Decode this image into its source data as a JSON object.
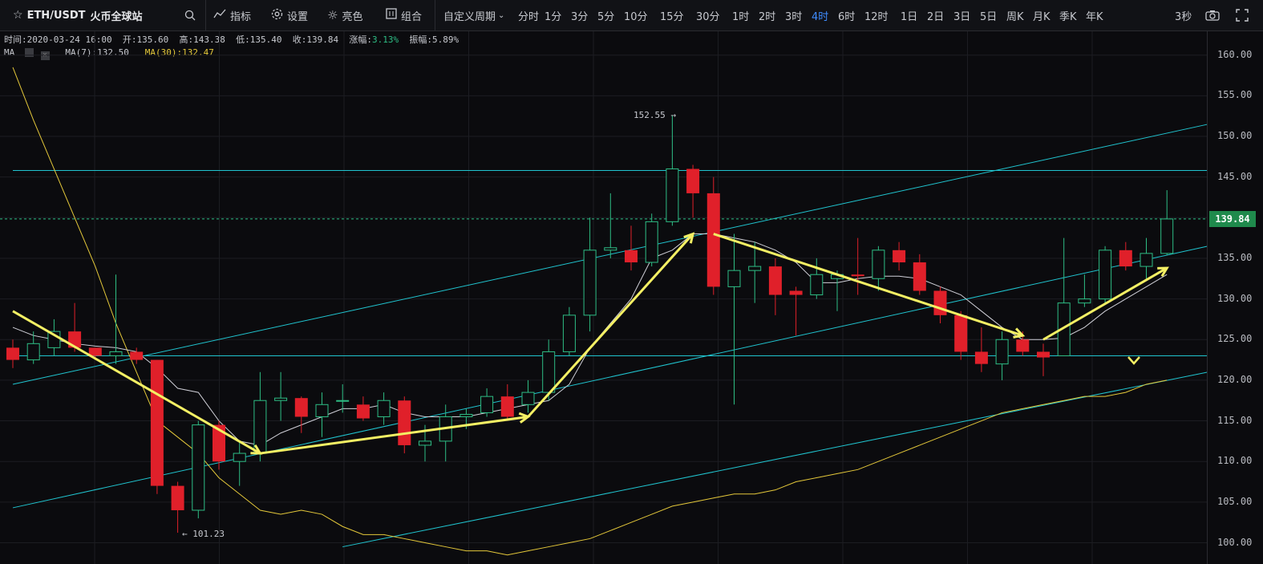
{
  "toolbar": {
    "pair": "ETH/USDT",
    "exchange": "火币全球站",
    "indicators": "指标",
    "settings": "设置",
    "brightness": "亮色",
    "combo": "组合",
    "custom_period": "自定义周期",
    "periods": [
      "分时",
      "1分",
      "3分",
      "5分",
      "10分",
      "15分",
      "30分",
      "1时",
      "2时",
      "3时",
      "4时",
      "6时",
      "12时",
      "1日",
      "2日",
      "3日",
      "5日",
      "周K",
      "月K",
      "季K",
      "年K"
    ],
    "active_period": "4时",
    "refresh": "3秒"
  },
  "info": {
    "time_label": "时间:",
    "time": "2020-03-24 16:00",
    "open_label": "开:",
    "open": "135.60",
    "high_label": "高:",
    "high": "143.38",
    "low_label": "低:",
    "low": "135.40",
    "close_label": "收:",
    "close": "139.84",
    "change_label": "涨幅:",
    "change": "3.13%",
    "amplitude_label": "振幅:",
    "amplitude": "5.89%",
    "ma_label": "MA",
    "ma7": "MA(7):132.50",
    "ma30": "MA(30):132.47"
  },
  "colors": {
    "up": "#2ebd85",
    "down": "#e0202a",
    "ma7": "#d0d0d8",
    "ma30": "#e4c83a",
    "trendline": "#20c4cf",
    "arrow": "#f4f064",
    "active": "#3f8cff"
  },
  "chart_data": {
    "type": "candlestick",
    "ylim": [
      100,
      160
    ],
    "y_ticks": [
      "160.00",
      "155.00",
      "150.00",
      "145.00",
      "140.00",
      "135.00",
      "130.00",
      "125.00",
      "120.00",
      "115.00",
      "110.00",
      "105.00",
      "100.00"
    ],
    "current_price": "139.84",
    "high_annotation": "152.55",
    "low_annotation": "101.23",
    "candles": [
      {
        "o": 124.0,
        "c": 122.5,
        "h": 125.0,
        "l": 121.5
      },
      {
        "o": 122.5,
        "c": 124.5,
        "h": 126.0,
        "l": 122.0
      },
      {
        "o": 124.0,
        "c": 126.0,
        "h": 127.5,
        "l": 123.0
      },
      {
        "o": 126.0,
        "c": 124.0,
        "h": 129.5,
        "l": 123.5
      },
      {
        "o": 124.0,
        "c": 123.0,
        "h": 124.0,
        "l": 122.5
      },
      {
        "o": 123.0,
        "c": 123.5,
        "h": 133.0,
        "l": 122.0
      },
      {
        "o": 123.5,
        "c": 122.5,
        "h": 124.0,
        "l": 122.0
      },
      {
        "o": 122.5,
        "c": 107.0,
        "h": 122.5,
        "l": 106.0
      },
      {
        "o": 107.0,
        "c": 104.0,
        "h": 107.5,
        "l": 101.23
      },
      {
        "o": 104.0,
        "c": 114.5,
        "h": 115.0,
        "l": 103.0
      },
      {
        "o": 114.5,
        "c": 110.0,
        "h": 115.0,
        "l": 109.0
      },
      {
        "o": 110.0,
        "c": 111.0,
        "h": 112.5,
        "l": 107.0
      },
      {
        "o": 111.0,
        "c": 117.5,
        "h": 121.0,
        "l": 110.0
      },
      {
        "o": 117.5,
        "c": 117.8,
        "h": 121.0,
        "l": 115.0
      },
      {
        "o": 117.8,
        "c": 115.5,
        "h": 118.0,
        "l": 113.5
      },
      {
        "o": 115.5,
        "c": 117.0,
        "h": 118.5,
        "l": 113.0
      },
      {
        "o": 117.5,
        "c": 117.5,
        "h": 119.5,
        "l": 116.0
      },
      {
        "o": 117.0,
        "c": 115.3,
        "h": 118.0,
        "l": 115.0
      },
      {
        "o": 115.5,
        "c": 117.5,
        "h": 118.5,
        "l": 114.5
      },
      {
        "o": 117.5,
        "c": 112.0,
        "h": 118.0,
        "l": 111.0
      },
      {
        "o": 112.0,
        "c": 112.5,
        "h": 114.5,
        "l": 110.0
      },
      {
        "o": 112.5,
        "c": 115.5,
        "h": 117.0,
        "l": 110.0
      },
      {
        "o": 115.5,
        "c": 115.8,
        "h": 116.5,
        "l": 114.0
      },
      {
        "o": 116.0,
        "c": 118.0,
        "h": 119.0,
        "l": 115.5
      },
      {
        "o": 118.0,
        "c": 115.5,
        "h": 119.5,
        "l": 115.0
      },
      {
        "o": 117.0,
        "c": 118.5,
        "h": 120.0,
        "l": 116.0
      },
      {
        "o": 118.5,
        "c": 123.5,
        "h": 125.0,
        "l": 117.5
      },
      {
        "o": 123.5,
        "c": 128.0,
        "h": 129.0,
        "l": 123.0
      },
      {
        "o": 128.0,
        "c": 136.0,
        "h": 140.0,
        "l": 126.0
      },
      {
        "o": 136.0,
        "c": 136.3,
        "h": 143.0,
        "l": 135.0
      },
      {
        "o": 136.0,
        "c": 134.5,
        "h": 139.0,
        "l": 133.5
      },
      {
        "o": 134.5,
        "c": 139.5,
        "h": 140.5,
        "l": 134.0
      },
      {
        "o": 139.5,
        "c": 146.0,
        "h": 152.55,
        "l": 139.0
      },
      {
        "o": 146.0,
        "c": 143.0,
        "h": 146.5,
        "l": 140.0
      },
      {
        "o": 143.0,
        "c": 131.5,
        "h": 145.0,
        "l": 130.5
      },
      {
        "o": 131.5,
        "c": 133.5,
        "h": 138.0,
        "l": 117.0
      },
      {
        "o": 133.5,
        "c": 134.0,
        "h": 137.0,
        "l": 129.5
      },
      {
        "o": 134.0,
        "c": 130.5,
        "h": 135.0,
        "l": 128.0
      },
      {
        "o": 131.0,
        "c": 130.5,
        "h": 131.5,
        "l": 125.5
      },
      {
        "o": 130.5,
        "c": 133.0,
        "h": 135.0,
        "l": 130.0
      },
      {
        "o": 132.5,
        "c": 133.0,
        "h": 133.5,
        "l": 128.5
      },
      {
        "o": 133.0,
        "c": 132.8,
        "h": 137.5,
        "l": 130.5
      },
      {
        "o": 132.5,
        "c": 136.0,
        "h": 136.5,
        "l": 131.0
      },
      {
        "o": 136.0,
        "c": 134.5,
        "h": 137.0,
        "l": 133.5
      },
      {
        "o": 134.5,
        "c": 131.0,
        "h": 135.5,
        "l": 130.5
      },
      {
        "o": 131.0,
        "c": 128.0,
        "h": 131.5,
        "l": 127.0
      },
      {
        "o": 128.0,
        "c": 123.5,
        "h": 128.5,
        "l": 122.5
      },
      {
        "o": 123.5,
        "c": 122.0,
        "h": 126.5,
        "l": 121.0
      },
      {
        "o": 122.0,
        "c": 125.0,
        "h": 126.0,
        "l": 120.0
      },
      {
        "o": 125.0,
        "c": 123.5,
        "h": 126.0,
        "l": 123.0
      },
      {
        "o": 123.5,
        "c": 122.8,
        "h": 124.5,
        "l": 120.5
      },
      {
        "o": 123.0,
        "c": 129.5,
        "h": 137.5,
        "l": 123.0
      },
      {
        "o": 129.5,
        "c": 130.0,
        "h": 133.0,
        "l": 129.0
      },
      {
        "o": 130.0,
        "c": 136.0,
        "h": 136.5,
        "l": 129.5
      },
      {
        "o": 136.0,
        "c": 134.0,
        "h": 137.0,
        "l": 133.5
      },
      {
        "o": 134.0,
        "c": 135.6,
        "h": 137.5,
        "l": 132.5
      },
      {
        "o": 135.6,
        "c": 139.84,
        "h": 143.38,
        "l": 135.4
      }
    ],
    "ma30": [
      158.5,
      152,
      146,
      140,
      134,
      127,
      121,
      115,
      113,
      111,
      108,
      106,
      104,
      103.5,
      104,
      103.5,
      102,
      101,
      101,
      100.5,
      100,
      99.5,
      99,
      99,
      98.5,
      99,
      99.5,
      100,
      100.5,
      101.5,
      102.5,
      103.5,
      104.5,
      105,
      105.5,
      106,
      106,
      106.5,
      107.5,
      108,
      108.5,
      109,
      110,
      111,
      112,
      113,
      114,
      115,
      116,
      116.5,
      117,
      117.5,
      118,
      118,
      118.5,
      119.5,
      120
    ],
    "ma7": [
      126.5,
      125.5,
      125,
      124.5,
      124.2,
      124,
      123.5,
      121.5,
      119,
      118.5,
      115,
      112.5,
      112,
      113.5,
      114.5,
      115.5,
      116.5,
      116.5,
      117,
      116,
      115.5,
      115.5,
      115.5,
      116,
      116.5,
      117,
      117.5,
      119.5,
      124,
      127,
      130,
      135,
      136,
      138,
      138,
      137.5,
      137,
      136,
      134.5,
      132,
      132,
      132.5,
      132.8,
      132.8,
      132.5,
      131.5,
      130.5,
      128.5,
      126.5,
      125,
      125,
      125.2,
      126.5,
      128.5,
      130,
      131.5,
      133
    ],
    "trend_segments": [
      {
        "from": [
          0,
          128.5
        ],
        "to": [
          12,
          111.0
        ]
      },
      {
        "from": [
          12,
          111.0
        ],
        "to": [
          25,
          115.5
        ]
      },
      {
        "from": [
          25,
          115.5
        ],
        "to": [
          33,
          138.0
        ]
      },
      {
        "from": [
          34,
          138.0
        ],
        "to": [
          49,
          125.5
        ]
      },
      {
        "from": [
          50,
          125.0
        ],
        "to": [
          56,
          133.8
        ]
      }
    ],
    "hlines": [
      145.8,
      123.0
    ],
    "channel": [
      {
        "from": [
          0,
          119.5
        ],
        "to": [
          58,
          151.5
        ]
      },
      {
        "from": [
          0,
          104.3
        ],
        "to": [
          58,
          136.5
        ]
      },
      {
        "from": [
          16,
          99.5
        ],
        "to": [
          58,
          121.0
        ]
      }
    ]
  }
}
